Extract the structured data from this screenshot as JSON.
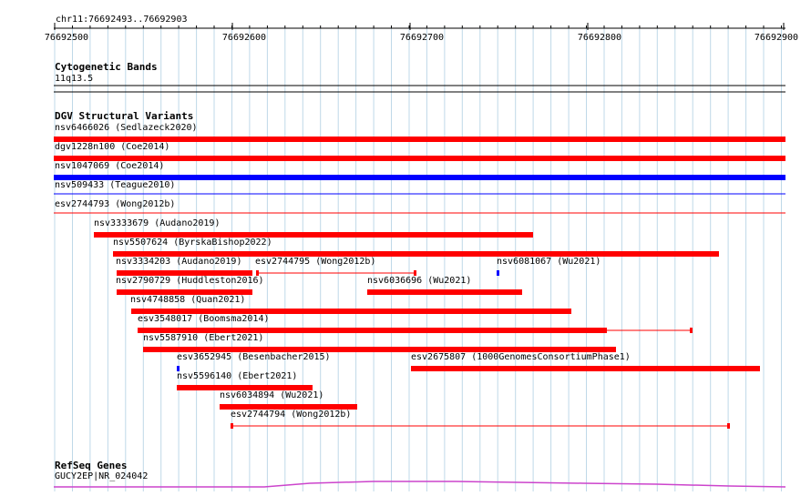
{
  "ruler": {
    "locus": "chr11:76692493..76692903",
    "ticks": [
      "76692500",
      "76692600",
      "76692700",
      "76692800",
      "76692900"
    ]
  },
  "tracks": {
    "cytoband": {
      "title": "Cytogenetic Bands",
      "band": "11q13.5"
    },
    "dgv": {
      "title": "DGV Structural Variants",
      "features": [
        {
          "label": "nsv6466026 (Sedlazeck2020)",
          "color": "#ff0000",
          "style": "solid"
        },
        {
          "label": "dgv1228n100 (Coe2014)",
          "color": "#ff0000",
          "style": "solid"
        },
        {
          "label": "nsv1047069 (Coe2014)",
          "color": "#0000ff",
          "style": "solid"
        },
        {
          "label": "nsv509433 (Teague2010)",
          "color": "#0000ff",
          "style": "line"
        },
        {
          "label": "esv2744793 (Wong2012b)",
          "color": "#ff0000",
          "style": "line"
        },
        {
          "label": "nsv3333679 (Audano2019)",
          "color": "#ff0000",
          "style": "solid"
        },
        {
          "label": "nsv5507624 (ByrskaBishop2022)",
          "color": "#ff0000",
          "style": "solid"
        },
        {
          "label": "nsv3334203 (Audano2019)",
          "color": "#ff0000",
          "style": "solid"
        },
        {
          "label": "esv2744795 (Wong2012b)",
          "color": "#ff0000",
          "style": "ends"
        },
        {
          "label": "nsv6081067 (Wu2021)",
          "color": "#0000ff",
          "style": "solid"
        },
        {
          "label": "nsv2790729 (Huddleston2016)",
          "color": "#ff0000",
          "style": "solid"
        },
        {
          "label": "nsv6036696 (Wu2021)",
          "color": "#ff0000",
          "style": "solid"
        },
        {
          "label": "nsv4748858 (Quan2021)",
          "color": "#ff0000",
          "style": "solid"
        },
        {
          "label": "esv3548017 (Boomsma2014)",
          "color": "#ff0000",
          "style": "partial"
        },
        {
          "label": "nsv5587910 (Ebert2021)",
          "color": "#ff0000",
          "style": "solid"
        },
        {
          "label": "esv3652945 (Besenbacher2015)",
          "color": "#0000ff",
          "style": "solid"
        },
        {
          "label": "esv2675807 (1000GenomesConsortiumPhase1)",
          "color": "#ff0000",
          "style": "solid"
        },
        {
          "label": "nsv5596140 (Ebert2021)",
          "color": "#ff0000",
          "style": "solid"
        },
        {
          "label": "nsv6034894 (Wu2021)",
          "color": "#ff0000",
          "style": "solid"
        },
        {
          "label": "esv2744794 (Wong2012b)",
          "color": "#ff0000",
          "style": "ends"
        }
      ]
    },
    "refseq": {
      "title": "RefSeq Genes",
      "gene": "GUCY2EP|NR_024042",
      "color": "#cc44cc"
    }
  }
}
